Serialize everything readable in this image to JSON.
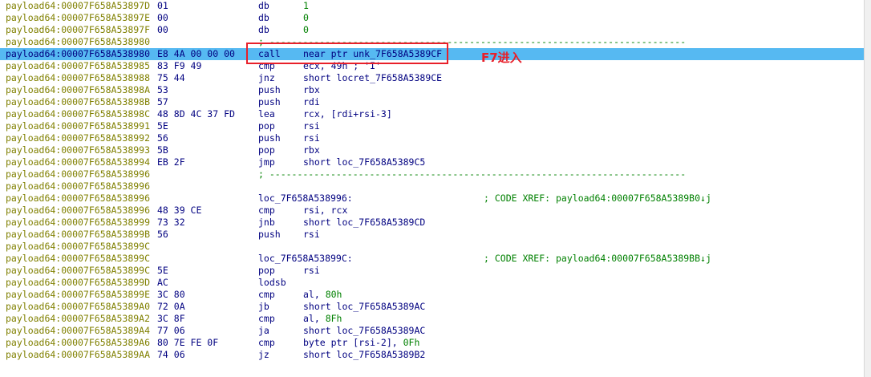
{
  "disassembly": {
    "lines": [
      {
        "addr": "payload64:00007F658A53897D",
        "bytes": "01",
        "mnem": "db",
        "ops": "1",
        "ops_num": true
      },
      {
        "addr": "payload64:00007F658A53897E",
        "bytes": "00",
        "mnem": "db",
        "ops": "0",
        "ops_num": true
      },
      {
        "addr": "payload64:00007F658A53897F",
        "bytes": "00",
        "mnem": "db",
        "ops": "0",
        "ops_num": true
      },
      {
        "addr": "payload64:00007F658A538980",
        "sep": "; ---------------------------------------------------------------------------"
      },
      {
        "addr": "payload64:00007F658A538980",
        "bytes": "E8 4A 00 00 00",
        "mnem": "call",
        "ops": "near ptr unk_7F658A5389CF",
        "current": true
      },
      {
        "addr": "payload64:00007F658A538985",
        "bytes": "83 F9 49",
        "mnem": "cmp",
        "ops": "ecx, 49h ; 'I'"
      },
      {
        "addr": "payload64:00007F658A538988",
        "bytes": "75 44",
        "mnem": "jnz",
        "ops": "short locret_7F658A5389CE"
      },
      {
        "addr": "payload64:00007F658A53898A",
        "bytes": "53",
        "mnem": "push",
        "ops": "rbx"
      },
      {
        "addr": "payload64:00007F658A53898B",
        "bytes": "57",
        "mnem": "push",
        "ops": "rdi"
      },
      {
        "addr": "payload64:00007F658A53898C",
        "bytes": "48 8D 4C 37 FD",
        "mnem": "lea",
        "ops": "rcx, [rdi+rsi-3]"
      },
      {
        "addr": "payload64:00007F658A538991",
        "bytes": "5E",
        "mnem": "pop",
        "ops": "rsi"
      },
      {
        "addr": "payload64:00007F658A538992",
        "bytes": "56",
        "mnem": "push",
        "ops": "rsi"
      },
      {
        "addr": "payload64:00007F658A538993",
        "bytes": "5B",
        "mnem": "pop",
        "ops": "rbx"
      },
      {
        "addr": "payload64:00007F658A538994",
        "bytes": "EB 2F",
        "mnem": "jmp",
        "ops": "short loc_7F658A5389C5"
      },
      {
        "addr": "payload64:00007F658A538996",
        "sep": "; ---------------------------------------------------------------------------"
      },
      {
        "addr": "payload64:00007F658A538996"
      },
      {
        "addr": "payload64:00007F658A538996",
        "label": "loc_7F658A538996:",
        "xref": "; CODE XREF: payload64:00007F658A5389B0↓j"
      },
      {
        "addr": "payload64:00007F658A538996",
        "bytes": "48 39 CE",
        "mnem": "cmp",
        "ops": "rsi, rcx"
      },
      {
        "addr": "payload64:00007F658A538999",
        "bytes": "73 32",
        "mnem": "jnb",
        "ops": "short loc_7F658A5389CD"
      },
      {
        "addr": "payload64:00007F658A53899B",
        "bytes": "56",
        "mnem": "push",
        "ops": "rsi"
      },
      {
        "addr": "payload64:00007F658A53899C"
      },
      {
        "addr": "payload64:00007F658A53899C",
        "label": "loc_7F658A53899C:",
        "xref": "; CODE XREF: payload64:00007F658A5389BB↓j"
      },
      {
        "addr": "payload64:00007F658A53899C",
        "bytes": "5E",
        "mnem": "pop",
        "ops": "rsi"
      },
      {
        "addr": "payload64:00007F658A53899D",
        "bytes": "AC",
        "mnem": "lodsb",
        "ops": ""
      },
      {
        "addr": "payload64:00007F658A53899E",
        "bytes": "3C 80",
        "mnem": "cmp",
        "ops_pre": "al, ",
        "ops_num_part": "80h"
      },
      {
        "addr": "payload64:00007F658A5389A0",
        "bytes": "72 0A",
        "mnem": "jb",
        "ops": "short loc_7F658A5389AC"
      },
      {
        "addr": "payload64:00007F658A5389A2",
        "bytes": "3C 8F",
        "mnem": "cmp",
        "ops_pre": "al, ",
        "ops_num_part": "8Fh"
      },
      {
        "addr": "payload64:00007F658A5389A4",
        "bytes": "77 06",
        "mnem": "ja",
        "ops": "short loc_7F658A5389AC"
      },
      {
        "addr": "payload64:00007F658A5389A6",
        "bytes": "80 7E FE 0F",
        "mnem": "cmp",
        "ops_pre": "byte ptr [rsi-2], ",
        "ops_num_part": "0Fh"
      },
      {
        "addr": "payload64:00007F658A5389AA",
        "bytes": "74 06",
        "mnem": "jz",
        "ops": "short loc_7F658A5389B2"
      }
    ]
  },
  "annotation": {
    "text": "F7进入"
  }
}
